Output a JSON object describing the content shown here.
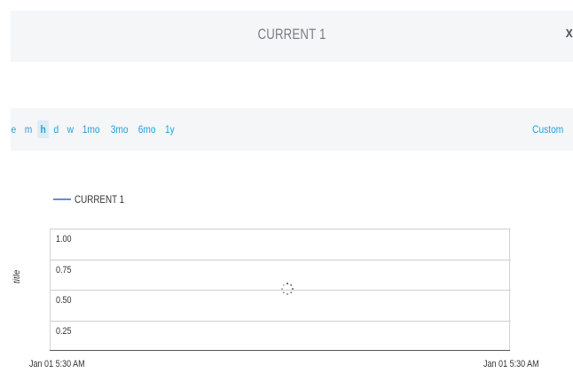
{
  "header": {
    "title": "CURRENT 1",
    "close_label": "x"
  },
  "range": {
    "options": [
      "e",
      "m",
      "h",
      "d",
      "w",
      "1mo",
      "3mo",
      "6mo",
      "1y"
    ],
    "active": "h",
    "custom_label": "Custom"
  },
  "chart_data": {
    "type": "line",
    "series": [
      {
        "name": "CURRENT 1",
        "values": []
      }
    ],
    "ylabel": "title",
    "yticks": [
      "1.00",
      "0.75",
      "0.50",
      "0.25"
    ],
    "x": [
      "Jan 01 5:30 AM",
      "Jan 01 5:30 AM"
    ],
    "loading": true,
    "colors": {
      "series": "#5b8fd9"
    }
  }
}
